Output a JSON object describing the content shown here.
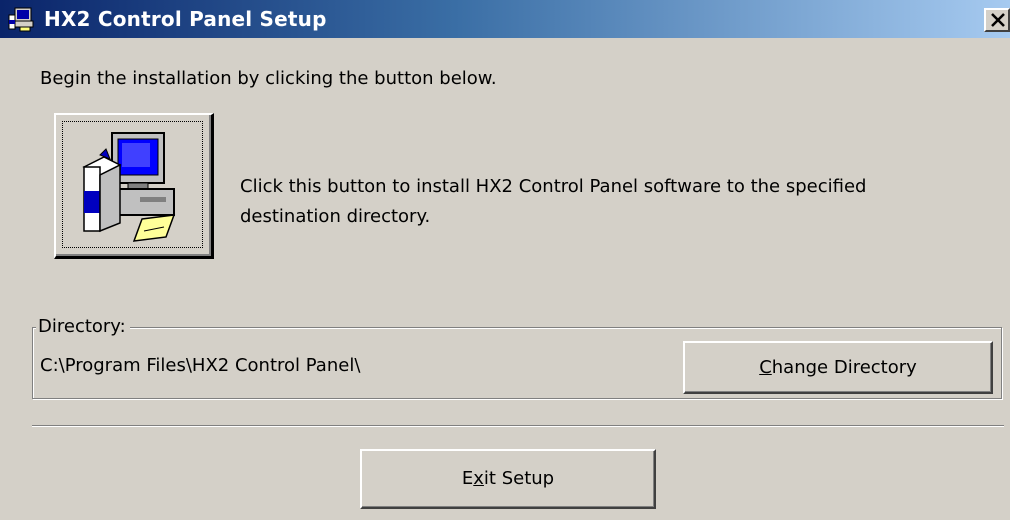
{
  "window": {
    "title": "HX2 Control Panel Setup",
    "title_icon": "setup-installer-icon",
    "close_glyph": "✕"
  },
  "intro": {
    "text": "Begin the installation by clicking the button below."
  },
  "install": {
    "button_icon": "computer-install-icon",
    "description": "Click this button to install HX2 Control Panel software to the specified destination directory."
  },
  "directory": {
    "group_label": "Directory:",
    "path": "C:\\Program Files\\HX2 Control Panel\\",
    "change_button": {
      "mnemonic": "C",
      "rest": "hange Directory"
    }
  },
  "exit_button": {
    "pre": "E",
    "mnemonic": "x",
    "post": "it Setup"
  },
  "colors": {
    "titlebar_start": "#0a246a",
    "titlebar_end": "#a6caf0",
    "face": "#d4d0c8"
  }
}
